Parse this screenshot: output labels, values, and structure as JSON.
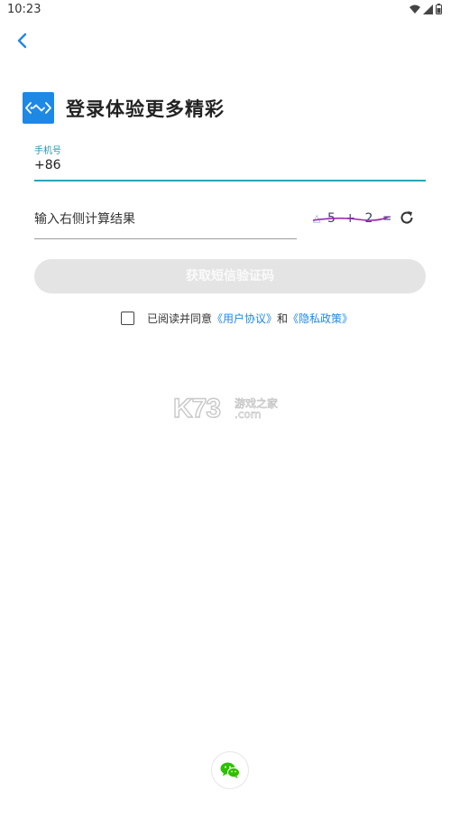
{
  "status_bar": {
    "time": "10:23"
  },
  "header": {
    "title": "登录体验更多精彩"
  },
  "phone": {
    "label": "手机号",
    "value": "+86"
  },
  "calc": {
    "placeholder": "输入右侧计算结果",
    "captcha_text": "5 + 2 ="
  },
  "sms_button": {
    "label": "获取短信验证码"
  },
  "agreement": {
    "prefix": "已阅读并同意",
    "user_agreement": "《用户协议》",
    "and": "和",
    "privacy_policy": "《隐私政策》"
  },
  "watermark": {
    "brand": "K73",
    "site_cn": "游戏之家",
    "site_domain": ".com"
  },
  "colors": {
    "accent": "#1e88e5",
    "focus_line": "#2aa5b8",
    "button_disabled": "#e4e4e4",
    "captcha_stroke": "#9b27b0"
  },
  "icons": {
    "back": "chevron-left-icon",
    "refresh": "refresh-icon",
    "wechat": "wechat-icon",
    "wifi": "wifi-icon",
    "signal": "signal-icon",
    "battery": "battery-icon"
  }
}
